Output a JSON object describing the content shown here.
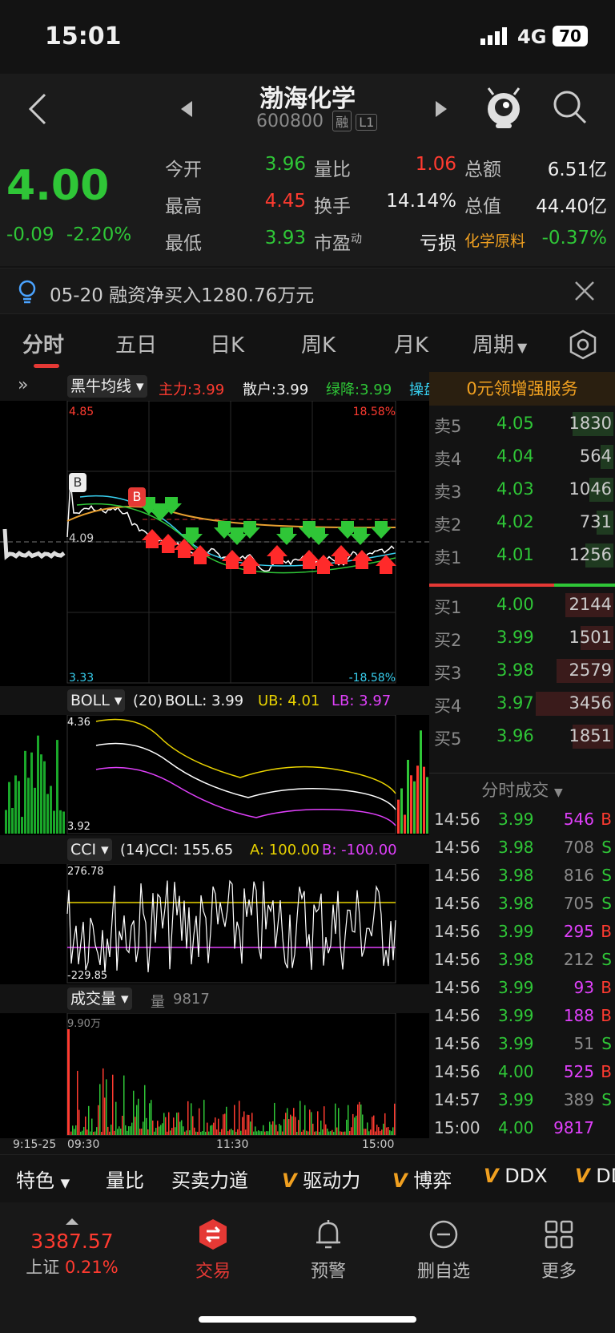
{
  "status": {
    "time": "15:01",
    "network": "4G",
    "battery": "70"
  },
  "header": {
    "title": "渤海化学",
    "code": "600800",
    "badge1": "融",
    "badge2": "L1"
  },
  "quote": {
    "price": "4.00",
    "change": "-0.09",
    "change_pct": "-2.20%",
    "fields": [
      {
        "label": "今开",
        "value": "3.96",
        "label2": "量比",
        "value2": "1.06",
        "label3": "总额",
        "value3": "6.51亿"
      },
      {
        "label": "最高",
        "value": "4.45",
        "label2": "换手",
        "value2": "14.14%",
        "label3": "总值",
        "value3": "44.40亿"
      },
      {
        "label": "最低",
        "value": "3.93",
        "label2": "市盈",
        "sup2": "动",
        "value2": "亏损",
        "label3": "化学原料",
        "value3": "-0.37%"
      }
    ]
  },
  "notice": {
    "text": "05-20 融资净买入1280.76万元"
  },
  "tabs": [
    "分时",
    "五日",
    "日K",
    "周K",
    "月K",
    "周期"
  ],
  "indicator": {
    "name": "黑牛均线",
    "zhuli": "主力:3.99",
    "sanhu": "散户:3.99",
    "lvjiang": "绿降:3.99",
    "cao": "操盘"
  },
  "main_chart": {
    "top_left": "4.85",
    "top_right": "18.58%",
    "mid": "4.09",
    "bot_left": "3.33",
    "bot_right": "-18.58%",
    "b_marker": "B"
  },
  "boll": {
    "name": "BOLL",
    "param": "(20)",
    "boll": "BOLL: 3.99",
    "ub": "UB: 4.01",
    "lb": "LB: 3.97",
    "top": "4.36",
    "bottom": "3.92"
  },
  "cci": {
    "name": "CCI",
    "param": "(14)",
    "cci": "CCI: 155.65",
    "a": "A: 100.00",
    "b": "B: -100.00",
    "top": "276.78",
    "bottom": "-229.85"
  },
  "volume": {
    "name": "成交量",
    "label": "量",
    "value": "9817",
    "max": "9.90万"
  },
  "time_axis": [
    "9:15-25",
    "09:30",
    "11:30",
    "15:00"
  ],
  "service_banner": "0元领增强服务",
  "order_book": {
    "asks": [
      {
        "label": "卖5",
        "price": "4.05",
        "vol": "1830",
        "fill": 0.22
      },
      {
        "label": "卖4",
        "price": "4.04",
        "vol": "564",
        "fill": 0.07
      },
      {
        "label": "卖3",
        "price": "4.03",
        "vol": "1046",
        "fill": 0.13
      },
      {
        "label": "卖2",
        "price": "4.02",
        "vol": "731",
        "fill": 0.09
      },
      {
        "label": "卖1",
        "price": "4.01",
        "vol": "1256",
        "fill": 0.15
      }
    ],
    "bids": [
      {
        "label": "买1",
        "price": "4.00",
        "vol": "2144",
        "fill": 0.26
      },
      {
        "label": "买2",
        "price": "3.99",
        "vol": "1501",
        "fill": 0.18
      },
      {
        "label": "买3",
        "price": "3.98",
        "vol": "2579",
        "fill": 0.31
      },
      {
        "label": "买4",
        "price": "3.97",
        "vol": "3456",
        "fill": 0.42
      },
      {
        "label": "买5",
        "price": "3.96",
        "vol": "1851",
        "fill": 0.22
      }
    ]
  },
  "ticks_title": "分时成交",
  "ticks": [
    {
      "time": "14:56",
      "price": "3.99",
      "vol": "546",
      "side": "B"
    },
    {
      "time": "14:56",
      "price": "3.98",
      "vol": "708",
      "side": "S"
    },
    {
      "time": "14:56",
      "price": "3.98",
      "vol": "816",
      "side": "S"
    },
    {
      "time": "14:56",
      "price": "3.98",
      "vol": "705",
      "side": "S"
    },
    {
      "time": "14:56",
      "price": "3.99",
      "vol": "295",
      "side": "B"
    },
    {
      "time": "14:56",
      "price": "3.98",
      "vol": "212",
      "side": "S"
    },
    {
      "time": "14:56",
      "price": "3.99",
      "vol": "93",
      "side": "B"
    },
    {
      "time": "14:56",
      "price": "3.99",
      "vol": "188",
      "side": "B"
    },
    {
      "time": "14:56",
      "price": "3.99",
      "vol": "51",
      "side": "S"
    },
    {
      "time": "14:56",
      "price": "4.00",
      "vol": "525",
      "side": "B"
    },
    {
      "time": "14:57",
      "price": "3.99",
      "vol": "389",
      "side": "S"
    },
    {
      "time": "15:00",
      "price": "4.00",
      "vol": "9817",
      "side": ""
    }
  ],
  "toolbar": [
    "特色",
    "量比",
    "买卖力道",
    "驱动力",
    "博弈",
    "DDX",
    "DD"
  ],
  "bottom_nav": {
    "index_value": "3387.57",
    "index_name": "上证",
    "index_pct": "0.21%",
    "trade": "交易",
    "alert": "预警",
    "remove": "删自选",
    "more": "更多"
  },
  "colors": {
    "up": "#ff3b30",
    "down": "#2fc637",
    "accent": "#e53935",
    "banner": "#f0a020"
  }
}
